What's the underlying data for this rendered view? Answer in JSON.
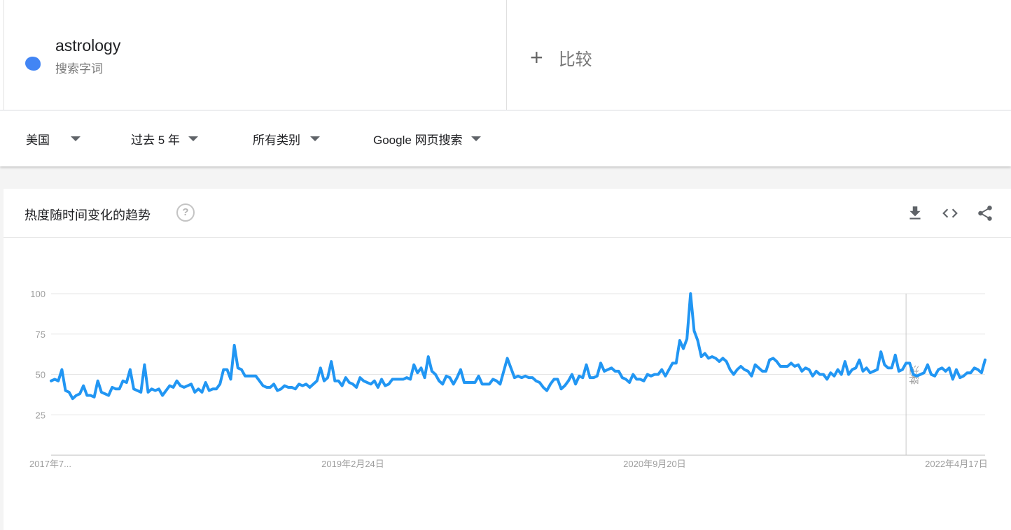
{
  "term": {
    "name": "astrology",
    "subtitle": "搜索字词",
    "color": "#4285f4"
  },
  "compare": {
    "plus": "+",
    "label": "比较"
  },
  "filters": [
    {
      "label": "美国"
    },
    {
      "label": "过去 5 年"
    },
    {
      "label": "所有类别"
    },
    {
      "label": "Google 网页搜索"
    }
  ],
  "panel": {
    "title": "热度随时间变化的趋势"
  },
  "icons": {
    "help": "help-icon",
    "download": "download-icon",
    "embed": "embed-icon",
    "share": "share-icon"
  },
  "chart_data": {
    "type": "line",
    "yticks": [
      25,
      50,
      75,
      100
    ],
    "ylim": [
      0,
      100
    ],
    "xticks": [
      {
        "label": "2017年7...",
        "index": 0
      },
      {
        "label": "2019年2月24日",
        "index": 84
      },
      {
        "label": "2020年9月20日",
        "index": 168
      },
      {
        "label": "2022年4月17日",
        "index": 252
      }
    ],
    "annotation": {
      "label": "注释",
      "index": 238
    },
    "line_color": "#2196f3",
    "values": [
      46,
      47,
      46,
      53,
      40,
      39,
      35,
      37,
      38,
      43,
      37,
      37,
      36,
      46,
      39,
      38,
      37,
      42,
      41,
      41,
      46,
      45,
      53,
      41,
      40,
      39,
      56,
      39,
      41,
      40,
      41,
      37,
      40,
      43,
      42,
      46,
      43,
      42,
      43,
      44,
      39,
      41,
      39,
      45,
      40,
      41,
      41,
      44,
      53,
      53,
      47,
      68,
      54,
      53,
      49,
      49,
      49,
      49,
      46,
      43,
      42,
      42,
      44,
      40,
      41,
      43,
      42,
      42,
      41,
      44,
      43,
      44,
      42,
      44,
      46,
      54,
      46,
      48,
      58,
      46,
      46,
      43,
      48,
      45,
      44,
      42,
      48,
      46,
      45,
      44,
      46,
      42,
      47,
      43,
      44,
      47,
      47,
      47,
      47,
      48,
      47,
      56,
      51,
      54,
      48,
      61,
      52,
      50,
      46,
      44,
      49,
      48,
      44,
      48,
      53,
      45,
      45,
      45,
      45,
      49,
      44,
      44,
      44,
      47,
      46,
      44,
      52,
      60,
      54,
      48,
      49,
      48,
      49,
      48,
      48,
      46,
      45,
      42,
      40,
      44,
      47,
      47,
      41,
      43,
      46,
      50,
      44,
      49,
      48,
      56,
      48,
      48,
      49,
      57,
      52,
      53,
      54,
      52,
      52,
      48,
      47,
      45,
      50,
      47,
      47,
      46,
      50,
      49,
      50,
      50,
      53,
      49,
      53,
      57,
      57,
      71,
      66,
      72,
      100,
      77,
      71,
      61,
      63,
      60,
      61,
      60,
      58,
      60,
      58,
      53,
      50,
      53,
      55,
      53,
      52,
      49,
      56,
      54,
      52,
      52,
      59,
      60,
      58,
      55,
      55,
      55,
      57,
      55,
      56,
      52,
      54,
      53,
      49,
      52,
      50,
      50,
      47,
      51,
      49,
      53,
      50,
      58,
      50,
      53,
      54,
      59,
      52,
      54,
      51,
      52,
      53,
      64,
      56,
      54,
      54,
      62,
      52,
      53,
      57,
      57,
      50,
      49,
      50,
      51,
      56,
      50,
      49,
      53,
      54,
      52,
      54,
      47,
      53,
      48,
      49,
      51,
      51,
      54,
      53,
      51,
      59
    ]
  }
}
